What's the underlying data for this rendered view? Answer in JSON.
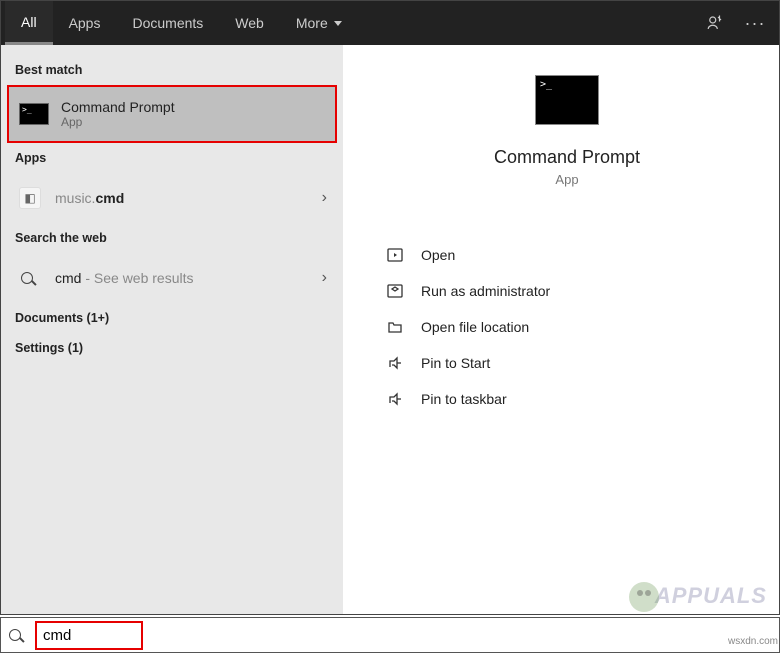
{
  "topbar": {
    "tabs": [
      "All",
      "Apps",
      "Documents",
      "Web",
      "More"
    ],
    "active_index": 0
  },
  "left": {
    "best_match_label": "Best match",
    "best_match": {
      "title": "Command Prompt",
      "subtitle": "App"
    },
    "apps_label": "Apps",
    "apps": [
      {
        "prefix": "music.",
        "match": "cmd"
      }
    ],
    "web_label": "Search the web",
    "web": {
      "match": "cmd",
      "suffix": " - See web results"
    },
    "documents_label": "Documents (1+)",
    "settings_label": "Settings (1)"
  },
  "right": {
    "title": "Command Prompt",
    "subtitle": "App",
    "actions": {
      "open": "Open",
      "run_admin": "Run as administrator",
      "open_loc": "Open file location",
      "pin_start": "Pin to Start",
      "pin_taskbar": "Pin to taskbar"
    }
  },
  "search": {
    "value": "cmd"
  },
  "watermark": "PPUALS",
  "footer": "wsxdn.com",
  "colors": {
    "highlight": "#e60000",
    "topbar": "#222222"
  }
}
